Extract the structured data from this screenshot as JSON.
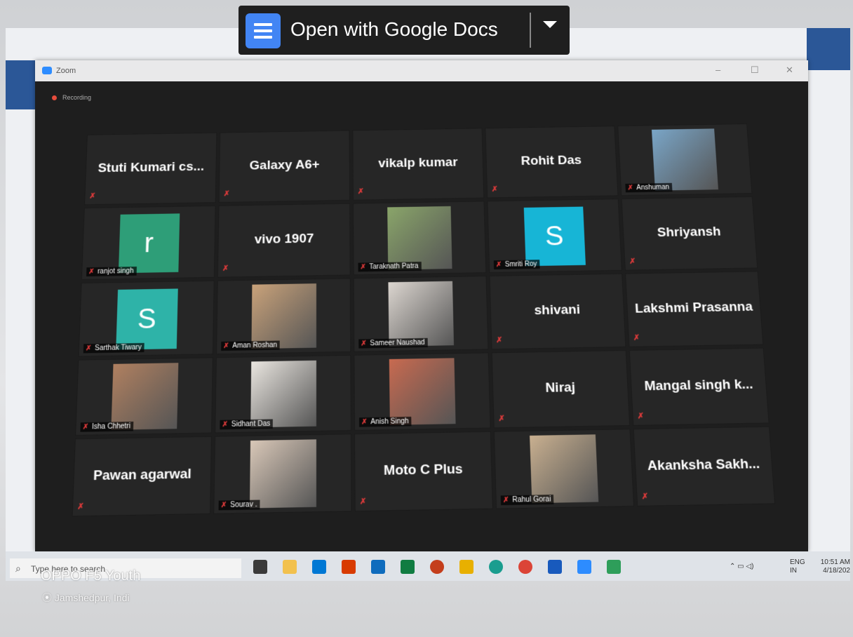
{
  "overlay": {
    "button_label": "Open with Google Docs"
  },
  "window": {
    "title": "Zoom",
    "recording": "Recording"
  },
  "participants": [
    {
      "name": "Stuti Kumari cs...",
      "kind": "name"
    },
    {
      "name": "Galaxy A6+",
      "kind": "name"
    },
    {
      "name": "vikalp kumar",
      "kind": "name"
    },
    {
      "name": "Rohit Das",
      "kind": "name"
    },
    {
      "name": "Anshuman",
      "kind": "photo",
      "color": "#7aa6c8"
    },
    {
      "name": "ranjot singh",
      "kind": "letter",
      "letter": "r",
      "color": "#2e9e78"
    },
    {
      "name": "vivo 1907",
      "kind": "name"
    },
    {
      "name": "Taraknath Patra",
      "kind": "photo",
      "color": "#8aa56a"
    },
    {
      "name": "Smriti Roy",
      "kind": "letter",
      "letter": "S",
      "color": "#17b5d6"
    },
    {
      "name": "Shriyansh",
      "kind": "name"
    },
    {
      "name": "Sarthak Tiwary",
      "kind": "letter",
      "letter": "S",
      "color": "#2eb3a8"
    },
    {
      "name": "Aman Roshan",
      "kind": "photo",
      "color": "#c9a27a"
    },
    {
      "name": "Sameer Naushad",
      "kind": "photo",
      "color": "#dcd6d0"
    },
    {
      "name": "shivani",
      "kind": "name"
    },
    {
      "name": "Lakshmi Prasanna",
      "kind": "name"
    },
    {
      "name": "Isha Chhetri",
      "kind": "photo",
      "color": "#b08060"
    },
    {
      "name": "Sidhant Das",
      "kind": "photo",
      "color": "#eae6e0"
    },
    {
      "name": "Anish Singh",
      "kind": "photo",
      "color": "#c86a50"
    },
    {
      "name": "Niraj",
      "kind": "name"
    },
    {
      "name": "Mangal singh k...",
      "kind": "name"
    },
    {
      "name": "Pawan agarwal",
      "kind": "name"
    },
    {
      "name": "Sourav .",
      "kind": "photo",
      "color": "#d9c8b8"
    },
    {
      "name": "Moto C Plus",
      "kind": "name"
    },
    {
      "name": "Rahul Gorai",
      "kind": "photo",
      "color": "#c9b090"
    },
    {
      "name": "Akanksha Sakh...",
      "kind": "name"
    }
  ],
  "taskbar": {
    "search_placeholder": "Type here to search",
    "lang": "ENG",
    "region": "IN",
    "time": "10:51 AM",
    "date": "4/18/202"
  },
  "watermark": {
    "device": "OPPO F5 Youth",
    "location": "Jamshedpur, Indi"
  }
}
